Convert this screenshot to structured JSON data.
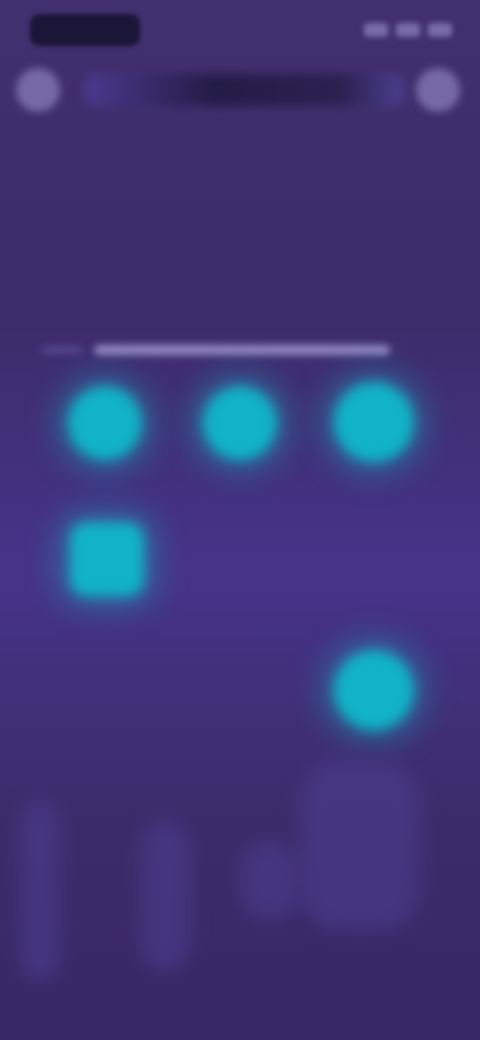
{
  "status_bar": {
    "time": ""
  },
  "header": {
    "title": ""
  },
  "pattern": {
    "dots": [
      {
        "id": "dot-1",
        "shape": "circle"
      },
      {
        "id": "dot-2",
        "shape": "circle"
      },
      {
        "id": "dot-3",
        "shape": "circle"
      },
      {
        "id": "dot-4",
        "shape": "square"
      },
      {
        "id": "dot-5",
        "shape": "circle"
      }
    ]
  },
  "colors": {
    "background": "#3e2e6c",
    "dot": "#11b3c7",
    "line": "#9d94cf"
  }
}
